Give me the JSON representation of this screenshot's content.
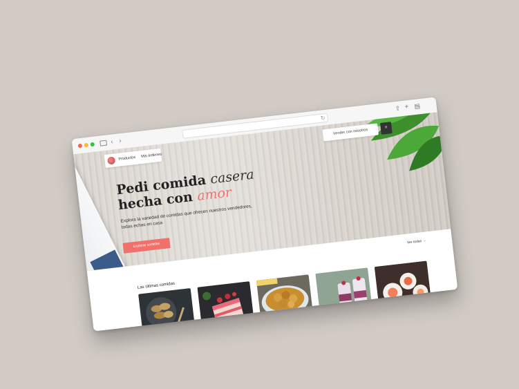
{
  "nav": {
    "products_label": "Productos",
    "orders_label": "Mis órdenes",
    "sell_label": "Vender con nosotros"
  },
  "hero": {
    "headline_line1_bold": "Pedi comida",
    "headline_line1_script": "casera",
    "headline_line2_bold": "hecha con",
    "headline_line2_script": "amor",
    "subtitle": "Explora la variedad de comidas que ofrecen nuestros vendedores, todas echas en casa",
    "cta_label": "Explorar comidas"
  },
  "latest": {
    "see_all_label": "Ver todas →",
    "section_title": "Las últimas comidas",
    "items": [
      {
        "icon": "empanadas-photo"
      },
      {
        "icon": "cake-photo"
      },
      {
        "icon": "fried-food-photo"
      },
      {
        "icon": "dessert-cups-photo"
      },
      {
        "icon": "sushi-photo"
      }
    ]
  },
  "colors": {
    "accent": "#f0716c",
    "background": "#d2cbc5"
  }
}
